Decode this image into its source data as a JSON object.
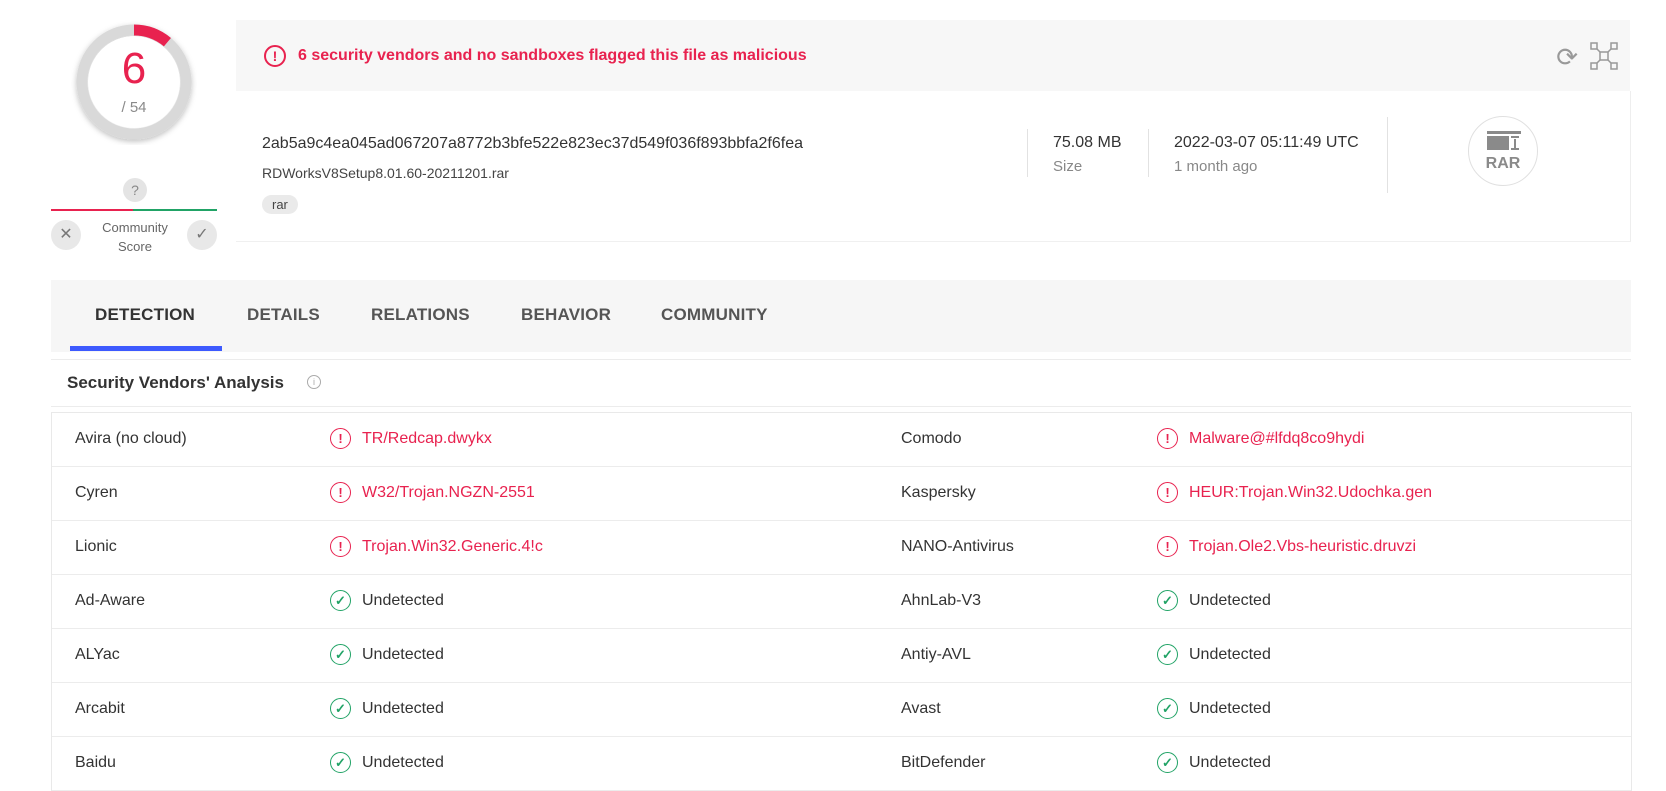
{
  "score": {
    "detections": "6",
    "total": "/ 54",
    "fraction_detected": 0.111
  },
  "community": {
    "question_icon": "?",
    "label_line1": "Community",
    "label_line2": "Score",
    "downvote_icon": "close-icon",
    "upvote_icon": "check-icon"
  },
  "alert": {
    "icon": "!",
    "text": "6 security vendors and no sandboxes flagged this file as malicious"
  },
  "file": {
    "hash": "2ab5a9c4ea045ad067207a8772b3bfe522e823ec37d549f036f893bbfa2f6fea",
    "name": "RDWorksV8Setup8.01.60-20211201.rar",
    "tag": "rar",
    "size_value": "75.08 MB",
    "size_label": "Size",
    "date_value": "2022-03-07 05:11:49 UTC",
    "date_ago": "1 month ago",
    "type_badge": "RAR"
  },
  "tabs": [
    {
      "label": "DETECTION",
      "active": true
    },
    {
      "label": "DETAILS",
      "active": false
    },
    {
      "label": "RELATIONS",
      "active": false
    },
    {
      "label": "BEHAVIOR",
      "active": false
    },
    {
      "label": "COMMUNITY",
      "active": false
    }
  ],
  "analysis": {
    "title": "Security Vendors' Analysis",
    "info_icon": "i",
    "rows": [
      {
        "left_vendor": "Avira (no cloud)",
        "left_result": "TR/Redcap.dwykx",
        "left_status": "bad",
        "right_vendor": "Comodo",
        "right_result": "Malware@#lfdq8co9hydi",
        "right_status": "bad"
      },
      {
        "left_vendor": "Cyren",
        "left_result": "W32/Trojan.NGZN-2551",
        "left_status": "bad",
        "right_vendor": "Kaspersky",
        "right_result": "HEUR:Trojan.Win32.Udochka.gen",
        "right_status": "bad"
      },
      {
        "left_vendor": "Lionic",
        "left_result": "Trojan.Win32.Generic.4!c",
        "left_status": "bad",
        "right_vendor": "NANO-Antivirus",
        "right_result": "Trojan.Ole2.Vbs-heuristic.druvzi",
        "right_status": "bad"
      },
      {
        "left_vendor": "Ad-Aware",
        "left_result": "Undetected",
        "left_status": "good",
        "right_vendor": "AhnLab-V3",
        "right_result": "Undetected",
        "right_status": "good"
      },
      {
        "left_vendor": "ALYac",
        "left_result": "Undetected",
        "left_status": "good",
        "right_vendor": "Antiy-AVL",
        "right_result": "Undetected",
        "right_status": "good"
      },
      {
        "left_vendor": "Arcabit",
        "left_result": "Undetected",
        "left_status": "good",
        "right_vendor": "Avast",
        "right_result": "Undetected",
        "right_status": "good"
      },
      {
        "left_vendor": "Baidu",
        "left_result": "Undetected",
        "left_status": "good",
        "right_vendor": "BitDefender",
        "right_result": "Undetected",
        "right_status": "good"
      }
    ]
  },
  "colors": {
    "malicious": "#e8224f",
    "clean": "#21a366",
    "tab_accent": "#3d5afe"
  }
}
